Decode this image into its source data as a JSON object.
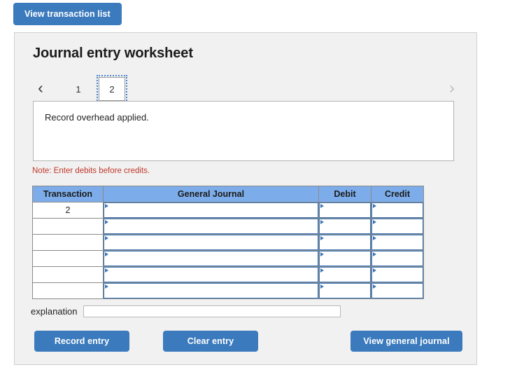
{
  "toolbar": {
    "view_transaction_list_label": "View transaction list"
  },
  "worksheet": {
    "title": "Journal entry worksheet",
    "tabs": [
      {
        "label": "1",
        "selected": false
      },
      {
        "label": "2",
        "selected": true
      }
    ],
    "nav": {
      "prev_icon": "chevron-left-icon",
      "next_icon": "chevron-right-icon",
      "prev_glyph": "‹",
      "next_glyph": "›"
    },
    "description": "Record overhead applied.",
    "note": "Note: Enter debits before credits.",
    "explanation": {
      "label": "explanation",
      "value": "",
      "placeholder": ""
    }
  },
  "table": {
    "columns": [
      "Transaction",
      "General Journal",
      "Debit",
      "Credit"
    ],
    "rows": [
      {
        "transaction": "2",
        "general_journal": "",
        "debit": "",
        "credit": ""
      },
      {
        "transaction": "",
        "general_journal": "",
        "debit": "",
        "credit": ""
      },
      {
        "transaction": "",
        "general_journal": "",
        "debit": "",
        "credit": ""
      },
      {
        "transaction": "",
        "general_journal": "",
        "debit": "",
        "credit": ""
      },
      {
        "transaction": "",
        "general_journal": "",
        "debit": "",
        "credit": ""
      },
      {
        "transaction": "",
        "general_journal": "",
        "debit": "",
        "credit": ""
      }
    ]
  },
  "footer": {
    "record_entry_label": "Record entry",
    "clear_entry_label": "Clear entry",
    "view_general_journal_label": "View general journal"
  },
  "colors": {
    "button_blue": "#3b7abd",
    "header_blue": "#7cadea",
    "note_red": "#c0392b",
    "panel_bg": "#f1f1f1",
    "input_border_blue": "#3f77b3"
  }
}
